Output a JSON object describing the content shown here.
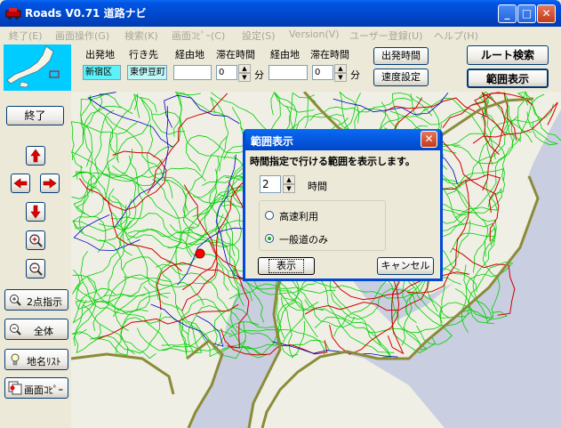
{
  "window": {
    "title": "Roads V0.71 道路ナビ"
  },
  "menu": [
    "終了(E)",
    "画面操作(G)",
    "検索(K)",
    "画面ｺﾋﾟｰ(C)",
    "設定(S)",
    "Version(V)",
    "ユーザー登録(U)",
    "ヘルプ(H)"
  ],
  "toolbar": {
    "origin_label": "出発地",
    "destination_label": "行き先",
    "waypoint1_label": "経由地",
    "stay1_label": "滞在時間",
    "waypoint2_label": "経由地",
    "stay2_label": "滞在時間",
    "origin_value": "新宿区",
    "destination_value": "東伊豆町",
    "waypoint1_value": "",
    "stay1_value": "0",
    "stay1_unit": "分",
    "waypoint2_value": "",
    "stay2_value": "0",
    "stay2_unit": "分",
    "departure_time_button": "出発時間",
    "speed_settings_button": "速度設定",
    "route_search_button": "ルート検索",
    "range_display_button": "範囲表示"
  },
  "sidebar": {
    "exit_button": "終了",
    "two_point_button": "2点指示",
    "whole_button": "全体",
    "place_list_button": "地名ﾘｽﾄ",
    "screen_copy_button": "画面ｺﾋﾟｰ"
  },
  "dialog": {
    "title": "範囲表示",
    "description": "時間指定で行ける範囲を表示します。",
    "hours_value": "2",
    "hours_unit": "時間",
    "option_highway": "高速利用",
    "option_general": "一般道のみ",
    "selected_option": "一般道のみ",
    "show_button": "表示",
    "cancel_button": "キャンセル"
  },
  "colors": {
    "titlebar": "#0054E3",
    "road_network": "#00D000",
    "highway": "#D00000",
    "rail": "#0000C0",
    "coast": "#8B8B3A",
    "map_land": "#EFEFE5",
    "map_sea": "#C9CEE0",
    "marker": "#FF0000",
    "origin_field": "#5CF2F9"
  }
}
